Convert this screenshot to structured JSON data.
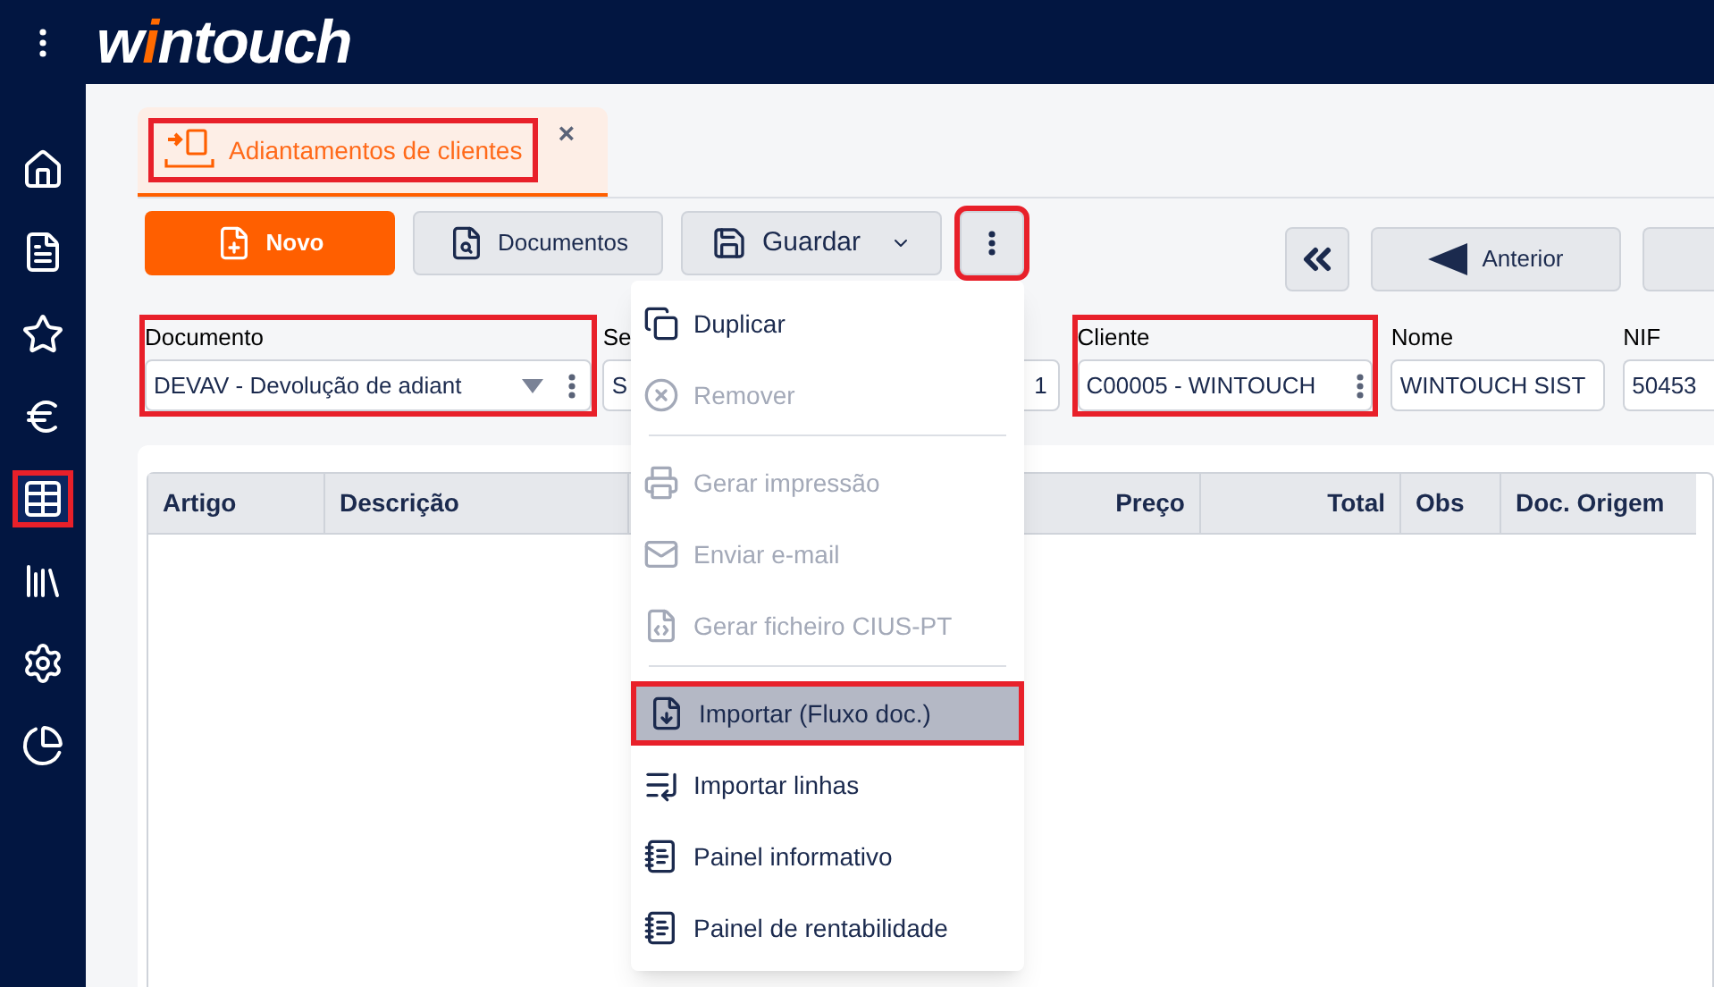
{
  "logo": [
    {
      "text": "w",
      "accent": false
    },
    {
      "text": "i",
      "accent": true
    },
    {
      "text": "ntouch",
      "accent": false
    }
  ],
  "sidebar": {
    "items": [
      {
        "selected": false,
        "highlighted": false
      },
      {
        "selected": false,
        "highlighted": false
      },
      {
        "selected": false,
        "highlighted": false
      },
      {
        "selected": false,
        "highlighted": false
      },
      {
        "selected": true,
        "highlighted": true
      },
      {
        "selected": false,
        "highlighted": false
      },
      {
        "selected": false,
        "highlighted": false
      },
      {
        "selected": false,
        "highlighted": false
      }
    ]
  },
  "tabs": [
    {
      "label": "Adiantamentos de clientes",
      "selected": true,
      "highlighted": true,
      "close": "×"
    }
  ],
  "toolbar": {
    "left": [
      {
        "kind": "primary",
        "label": "Novo",
        "highlighted": false
      },
      {
        "kind": "secondary",
        "label": "Documentos",
        "highlighted": false
      },
      {
        "kind": "split",
        "label": "Guardar",
        "highlighted": false
      },
      {
        "kind": "more",
        "highlighted": true
      }
    ],
    "right": [
      {
        "kind": "first",
        "highlighted": false
      },
      {
        "kind": "prev",
        "label": "Anterior",
        "highlighted": false
      },
      {
        "kind": "cut",
        "highlighted": false
      }
    ]
  },
  "fields": [
    {
      "kind": "select",
      "label": "Documento",
      "value": "DEVAV - Devolução de adiant",
      "highlighted": true
    },
    {
      "kind": "series",
      "label": "Se",
      "value": "S",
      "highlighted": false
    },
    {
      "kind": "number",
      "value": "1",
      "highlighted": false
    },
    {
      "kind": "lookup",
      "label": "Cliente",
      "value": "C00005 - WINTOUCH",
      "highlighted": true
    },
    {
      "kind": "text",
      "label": "Nome",
      "value": "WINTOUCH SIST",
      "highlighted": false
    },
    {
      "kind": "edge",
      "label": "NIF",
      "value": "50453",
      "highlighted": false
    }
  ],
  "table": {
    "columns": [
      {
        "label": "Artigo"
      },
      {
        "label": "Descrição"
      },
      {
        "label": "Preço"
      },
      {
        "label": "Total"
      },
      {
        "label": "Obs"
      },
      {
        "label": "Doc. Origem"
      }
    ]
  },
  "menu": {
    "items": [
      {
        "kind": "item",
        "label": "Duplicar",
        "disabled": false,
        "selected": false,
        "highlighted": false
      },
      {
        "kind": "item",
        "label": "Remover",
        "disabled": true,
        "selected": false,
        "highlighted": false
      },
      {
        "kind": "divider"
      },
      {
        "kind": "item",
        "label": "Gerar impressão",
        "disabled": true,
        "selected": false,
        "highlighted": false
      },
      {
        "kind": "item",
        "label": "Enviar e-mail",
        "disabled": true,
        "selected": false,
        "highlighted": false
      },
      {
        "kind": "item",
        "label": "Gerar ficheiro CIUS-PT",
        "disabled": true,
        "selected": false,
        "highlighted": false
      },
      {
        "kind": "divider"
      },
      {
        "kind": "item",
        "label": "Importar (Fluxo doc.)",
        "disabled": false,
        "selected": true,
        "highlighted": true
      },
      {
        "kind": "item",
        "label": "Importar linhas",
        "disabled": false,
        "selected": false,
        "highlighted": false
      },
      {
        "kind": "item",
        "label": "Painel informativo",
        "disabled": false,
        "selected": false,
        "highlighted": false
      },
      {
        "kind": "item",
        "label": "Painel de rentabilidade",
        "disabled": false,
        "selected": false,
        "highlighted": false
      }
    ]
  }
}
